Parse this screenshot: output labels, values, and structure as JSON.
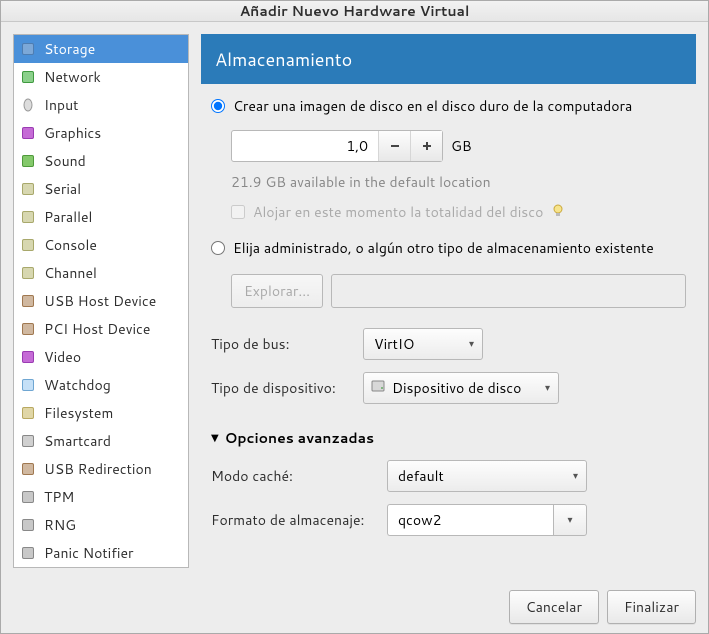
{
  "window": {
    "title": "Añadir Nuevo Hardware Virtual"
  },
  "sidebar": {
    "items": [
      {
        "label": "Storage",
        "icon": "storage-icon"
      },
      {
        "label": "Network",
        "icon": "network-icon"
      },
      {
        "label": "Input",
        "icon": "input-icon"
      },
      {
        "label": "Graphics",
        "icon": "graphics-icon"
      },
      {
        "label": "Sound",
        "icon": "sound-icon"
      },
      {
        "label": "Serial",
        "icon": "serial-icon"
      },
      {
        "label": "Parallel",
        "icon": "parallel-icon"
      },
      {
        "label": "Console",
        "icon": "console-icon"
      },
      {
        "label": "Channel",
        "icon": "channel-icon"
      },
      {
        "label": "USB Host Device",
        "icon": "usb-host-icon"
      },
      {
        "label": "PCI Host Device",
        "icon": "pci-host-icon"
      },
      {
        "label": "Video",
        "icon": "video-icon"
      },
      {
        "label": "Watchdog",
        "icon": "watchdog-icon"
      },
      {
        "label": "Filesystem",
        "icon": "filesystem-icon"
      },
      {
        "label": "Smartcard",
        "icon": "smartcard-icon"
      },
      {
        "label": "USB Redirection",
        "icon": "usb-redir-icon"
      },
      {
        "label": "TPM",
        "icon": "tpm-icon"
      },
      {
        "label": "RNG",
        "icon": "rng-icon"
      },
      {
        "label": "Panic Notifier",
        "icon": "panic-icon"
      }
    ]
  },
  "panel": {
    "title": "Almacenamiento",
    "radio_create": "Crear una imagen de disco en el disco duro de la computadora",
    "size_value": "1,0",
    "size_unit": "GB",
    "available": "21.9 GB available in the default location",
    "allocate_now": "Alojar en este momento la totalidad del disco",
    "radio_managed": "Elija administrado, o algún otro tipo de almacenamiento existente",
    "browse": "Explorar...",
    "bus_label": "Tipo de bus:",
    "bus_value": "VirtIO",
    "device_label": "Tipo de dispositivo:",
    "device_value": "Dispositivo de disco",
    "advanced": "Opciones avanzadas",
    "cache_label": "Modo caché:",
    "cache_value": "default",
    "format_label": "Formato de almacenaje:",
    "format_value": "qcow2"
  },
  "footer": {
    "cancel": "Cancelar",
    "finish": "Finalizar"
  }
}
